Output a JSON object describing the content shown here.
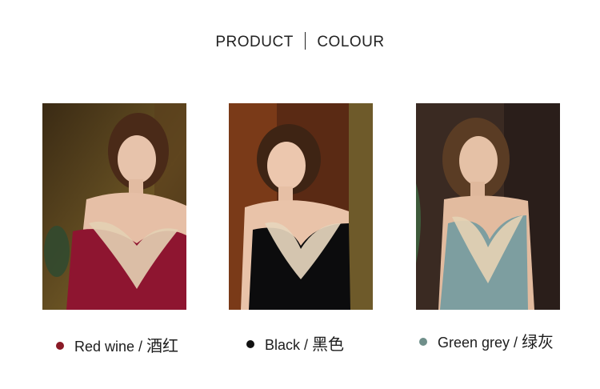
{
  "heading": {
    "left": "PRODUCT",
    "right": "COLOUR"
  },
  "colors": [
    {
      "name_en": "Red wine",
      "slash": " / ",
      "name_cn": "酒红",
      "swatch": "#8a1a26",
      "garment": "#8e1530"
    },
    {
      "name_en": "Black",
      "slash": " / ",
      "name_cn": "黑色",
      "swatch": "#111111",
      "garment": "#0c0c0d"
    },
    {
      "name_en": "Green grey",
      "slash": " / ",
      "name_cn": "绿灰",
      "swatch": "#6f8f8a",
      "garment": "#7d9ea0"
    }
  ]
}
